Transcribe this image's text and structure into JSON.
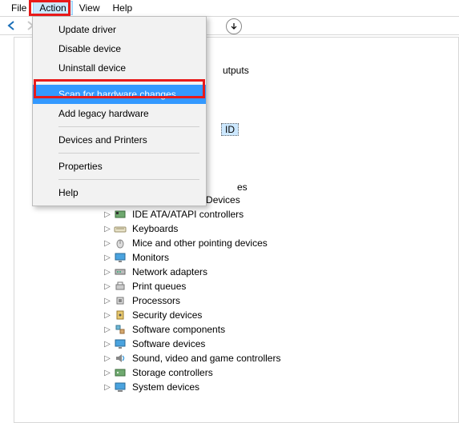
{
  "menubar": {
    "file": "File",
    "action": "Action",
    "view": "View",
    "help": "Help"
  },
  "action_menu": {
    "update_driver": "Update driver",
    "disable_device": "Disable device",
    "uninstall_device": "Uninstall device",
    "scan_hardware": "Scan for hardware changes",
    "add_legacy": "Add legacy hardware",
    "devices_printers": "Devices and Printers",
    "properties": "Properties",
    "help": "Help"
  },
  "peek": {
    "outputs": "utputs",
    "selected_suffix": "ID",
    "es_suffix": "es"
  },
  "tree": {
    "items": [
      {
        "label": "Human Interface Devices"
      },
      {
        "label": "IDE ATA/ATAPI controllers"
      },
      {
        "label": "Keyboards"
      },
      {
        "label": "Mice and other pointing devices"
      },
      {
        "label": "Monitors"
      },
      {
        "label": "Network adapters"
      },
      {
        "label": "Print queues"
      },
      {
        "label": "Processors"
      },
      {
        "label": "Security devices"
      },
      {
        "label": "Software components"
      },
      {
        "label": "Software devices"
      },
      {
        "label": "Sound, video and game controllers"
      },
      {
        "label": "Storage controllers"
      },
      {
        "label": "System devices"
      }
    ]
  }
}
